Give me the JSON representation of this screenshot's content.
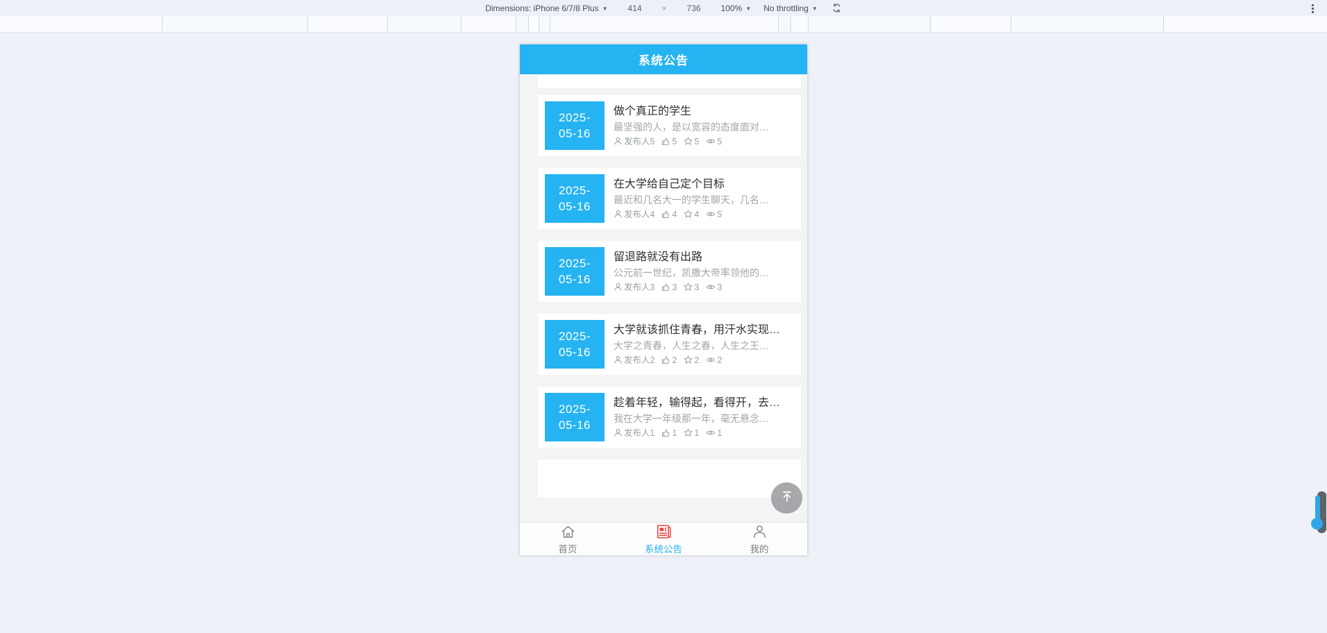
{
  "devtools": {
    "dimensions_label": "Dimensions: iPhone 6/7/8 Plus",
    "width_value": "414",
    "multiply_sign": "×",
    "height_value": "736",
    "zoom_value": "100%",
    "throttling_value": "No throttling"
  },
  "colors": {
    "accent_blue": "#26b3f2",
    "tab_icon_red": "#e64340",
    "inactive_gray": "#7a7e83"
  },
  "app": {
    "header": {
      "title": "系统公告"
    },
    "announcements": [
      {
        "date_top": "2025-",
        "date_bottom": "05-16",
        "title": "做个真正的学生",
        "summary": "最坚强的人，是以宽容的态度面对…",
        "publisher": "发布人5",
        "likes": "5",
        "favorites": "5",
        "views": "5"
      },
      {
        "date_top": "2025-",
        "date_bottom": "05-16",
        "title": "在大学给自己定个目标",
        "summary": "最近和几名大一的学生聊天，几名…",
        "publisher": "发布人4",
        "likes": "4",
        "favorites": "4",
        "views": "5"
      },
      {
        "date_top": "2025-",
        "date_bottom": "05-16",
        "title": "留退路就没有出路",
        "summary": "公元前一世纪，凯撒大帝率领他的…",
        "publisher": "发布人3",
        "likes": "3",
        "favorites": "3",
        "views": "3"
      },
      {
        "date_top": "2025-",
        "date_bottom": "05-16",
        "title": "大学就该抓住青春，用汗水实现…",
        "summary": "大学之青春，人生之春，人生之王…",
        "publisher": "发布人2",
        "likes": "2",
        "favorites": "2",
        "views": "2"
      },
      {
        "date_top": "2025-",
        "date_bottom": "05-16",
        "title": "趁着年轻，输得起，看得开，去…",
        "summary": "我在大学一年级那一年，毫无悬念…",
        "publisher": "发布人1",
        "likes": "1",
        "favorites": "1",
        "views": "1"
      }
    ],
    "tabbar": {
      "home_label": "首页",
      "announcements_label": "系统公告",
      "profile_label": "我的"
    }
  }
}
